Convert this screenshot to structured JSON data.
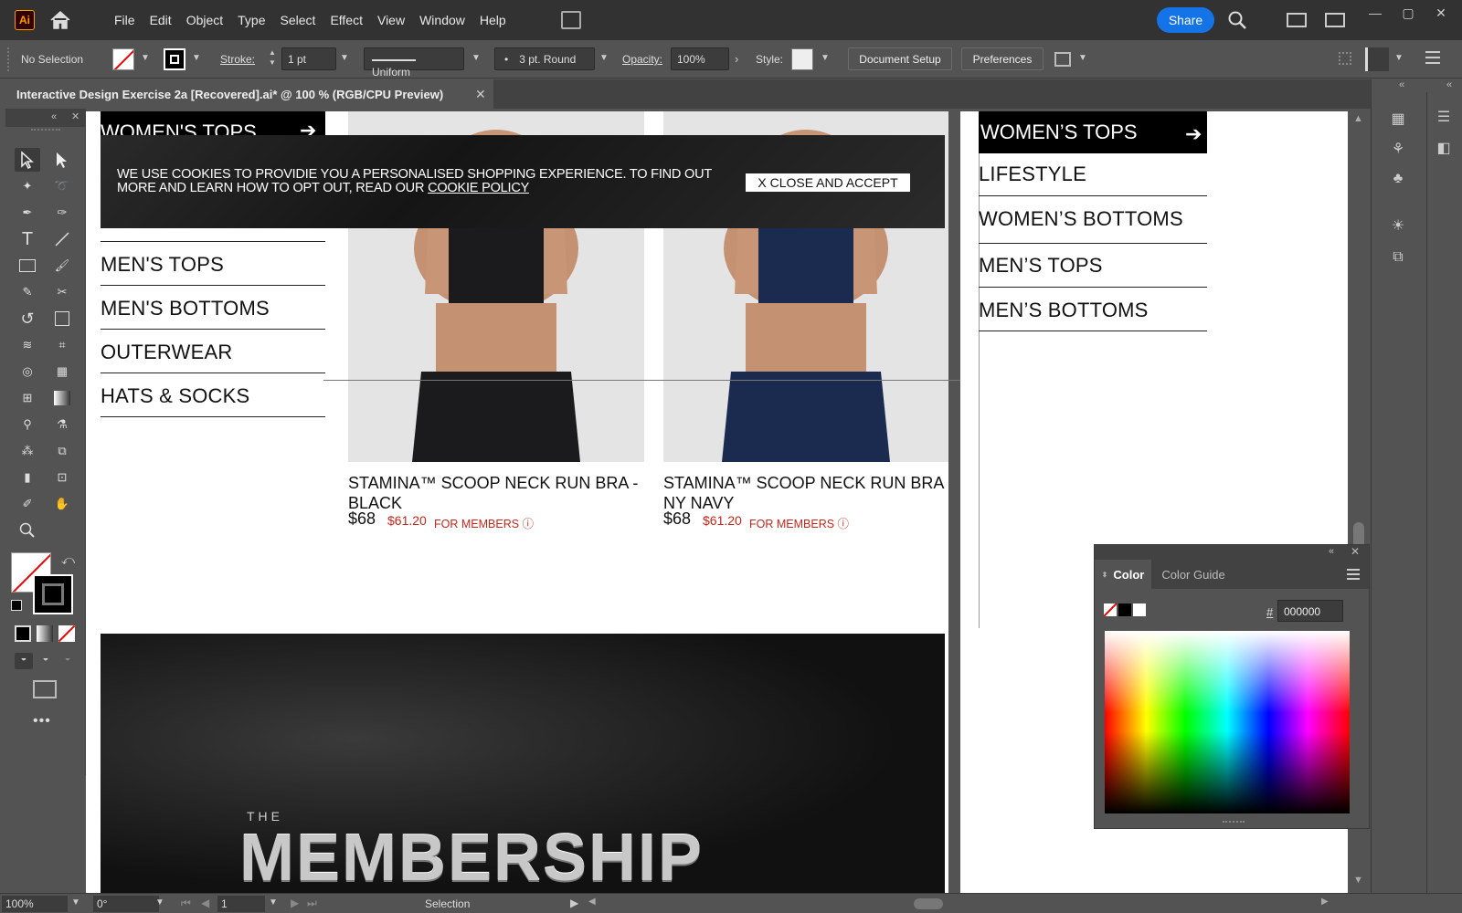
{
  "app": {
    "logo": "Ai"
  },
  "menu": [
    "File",
    "Edit",
    "Object",
    "Type",
    "Select",
    "Effect",
    "View",
    "Window",
    "Help"
  ],
  "header": {
    "share_label": "Share"
  },
  "control": {
    "selection": "No Selection",
    "stroke_label": "Stroke:",
    "stroke_value": "1 pt",
    "profile": "Uniform",
    "brush": "3 pt. Round",
    "opacity_label": "Opacity:",
    "opacity_value": "100%",
    "style_label": "Style:",
    "doc_setup": "Document Setup",
    "preferences": "Preferences"
  },
  "document": {
    "tab_title": "Interactive Design Exercise 2a [Recovered].ai* @ 100 % (RGB/CPU Preview)"
  },
  "artboard1": {
    "top_nav": "WOMEN'S TOPS",
    "cookie": {
      "text": "WE USE COOKIES TO PROVIDIE YOU A PERSONALISED SHOPPING EXPERIENCE. TO FIND OUT MORE AND LEARN HOW TO OPT OUT, READ OUR",
      "link": "COOKIE POLICY",
      "button": "X CLOSE AND ACCEPT"
    },
    "nav_items": [
      "MEN'S TOPS",
      "MEN'S BOTTOMS",
      "OUTERWEAR",
      "HATS & SOCKS"
    ],
    "products": [
      {
        "name_line1": "STAMINA™ SCOOP NECK RUN BRA -",
        "name_line2": "BLACK",
        "price": "$68",
        "member_price": "$61.20",
        "member_label": "FOR MEMBERS ⓘ",
        "color": "#1b1b1d"
      },
      {
        "name_line1": "STAMINA™ SCOOP NECK RUN BRA",
        "name_line2": "NY NAVY",
        "price": "$68",
        "member_price": "$61.20",
        "member_label": "FOR MEMBERS ⓘ",
        "color": "#1a2b4f"
      }
    ],
    "hero": {
      "small": "THE",
      "title": "MEMBERSHIP"
    }
  },
  "artboard2": {
    "nav_header": "WOMEN’S TOPS",
    "nav_items": [
      "LIFESTYLE",
      "WOMEN’S BOTTOMS",
      "MEN’S TOPS",
      "MEN’S BOTTOMS"
    ]
  },
  "color_panel": {
    "tabs": [
      "Color",
      "Color Guide"
    ],
    "hex_label": "#",
    "hex_value": "000000"
  },
  "status": {
    "zoom": "100%",
    "rotation": "0°",
    "artboard": "1",
    "tool": "Selection"
  }
}
